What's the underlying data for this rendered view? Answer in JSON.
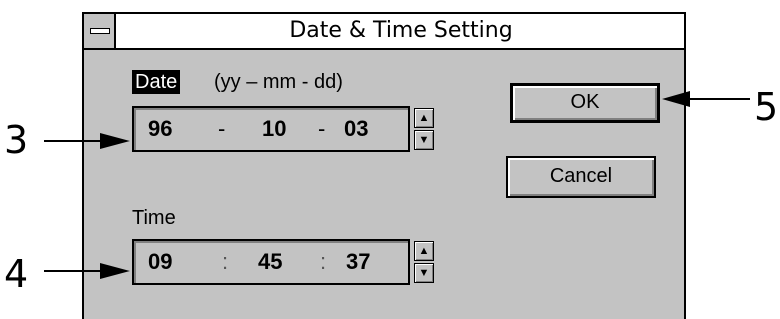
{
  "window": {
    "title": "Date & Time Setting"
  },
  "date": {
    "label": "Date",
    "format_hint": "(yy – mm - dd)",
    "year": "96",
    "month": "10",
    "day": "03",
    "separator": "-"
  },
  "time": {
    "label": "Time",
    "hour": "09",
    "minute": "45",
    "second": "37",
    "separator": ":"
  },
  "buttons": {
    "ok": "OK",
    "cancel": "Cancel"
  },
  "spinner": {
    "up_icon": "▲",
    "down_icon": "▼"
  },
  "callouts": {
    "date_field": "3",
    "time_field": "4",
    "ok_button": "5"
  }
}
